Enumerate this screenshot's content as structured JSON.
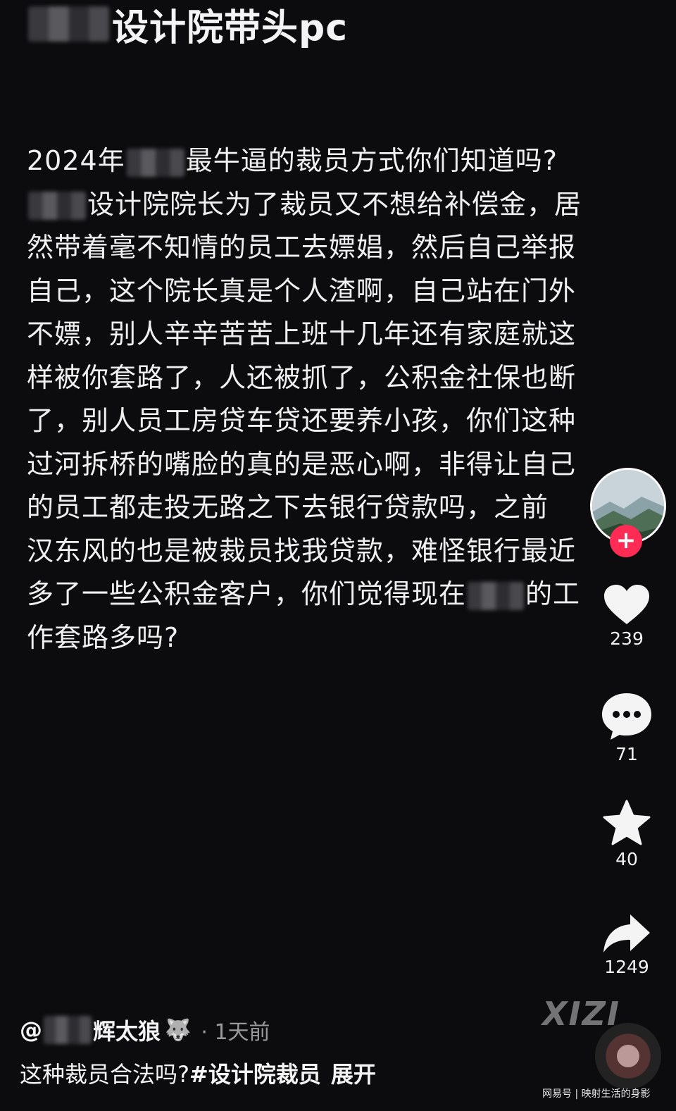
{
  "header": {
    "title": "设计院带头pc"
  },
  "post": {
    "lines": [
      [
        "2024年",
        "最牛逼的裁员方式你们知道吗?"
      ],
      [
        "",
        "设计院院长为了裁员又不想给补偿金，居"
      ],
      [
        "然带着毫不知情的员工去嫖娼，然后自己举报"
      ],
      [
        "自己，这个院长真是个人渣啊，自己站在门外"
      ],
      [
        "不嫖，别人辛辛苦苦上班十几年还有家庭就这"
      ],
      [
        "样被你套路了，人还被抓了，公积金社保也断"
      ],
      [
        "了，别人员工房贷车贷还要养小孩，你们这种"
      ],
      [
        "过河拆桥的嘴脸的真的是恶心啊，非得让自己"
      ],
      [
        "的员工都走投无路之下去银行贷款吗，之前"
      ],
      [
        "汉东风的也是被裁员找我贷款，难怪银行最近"
      ],
      [
        "多了一些公积金客户，你们觉得现在",
        "的工"
      ],
      [
        "作套路多吗?"
      ]
    ]
  },
  "actions": {
    "like_count": "239",
    "comment_count": "71",
    "favorite_count": "40",
    "share_count": "1249"
  },
  "author": {
    "at": "@",
    "name": "辉太狼",
    "time": "· 1天前"
  },
  "caption": {
    "text": "这种裁员合法吗?",
    "hashtag": "#设计院裁员",
    "expand": "展开"
  },
  "watermarks": {
    "xizi": "XIZI",
    "bottom": "网易号 | 映射生活的身影"
  },
  "colors": {
    "background": "#0c0b0e",
    "follow": "#fe2c55"
  }
}
